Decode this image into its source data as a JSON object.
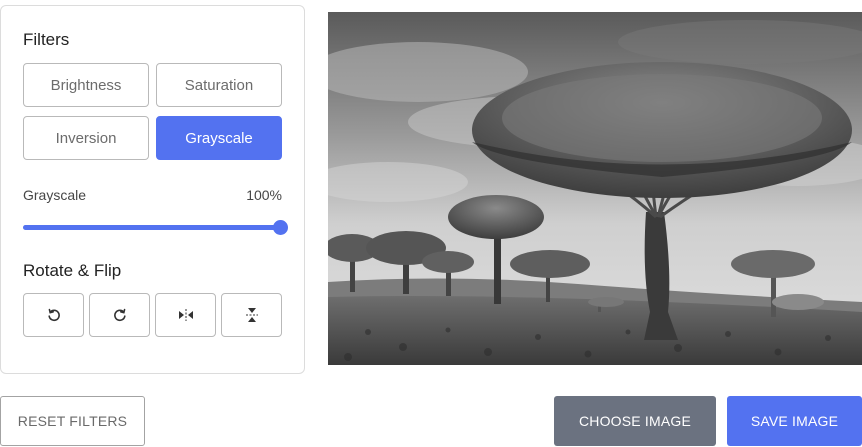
{
  "filters": {
    "title": "Filters",
    "buttons": [
      {
        "label": "Brightness",
        "active": false
      },
      {
        "label": "Saturation",
        "active": false
      },
      {
        "label": "Inversion",
        "active": false
      },
      {
        "label": "Grayscale",
        "active": true
      }
    ]
  },
  "slider": {
    "label": "Grayscale",
    "value_text": "100%",
    "value_percent": 100
  },
  "rotate": {
    "title": "Rotate & Flip",
    "buttons": [
      {
        "icon": "rotate-left-icon"
      },
      {
        "icon": "rotate-right-icon"
      },
      {
        "icon": "flip-horizontal-icon"
      },
      {
        "icon": "flip-vertical-icon"
      }
    ]
  },
  "actions": {
    "reset_label": "RESET FILTERS",
    "choose_label": "CHOOSE IMAGE",
    "save_label": "SAVE IMAGE"
  },
  "colors": {
    "accent": "#5372f0",
    "secondary": "#6b7280"
  }
}
